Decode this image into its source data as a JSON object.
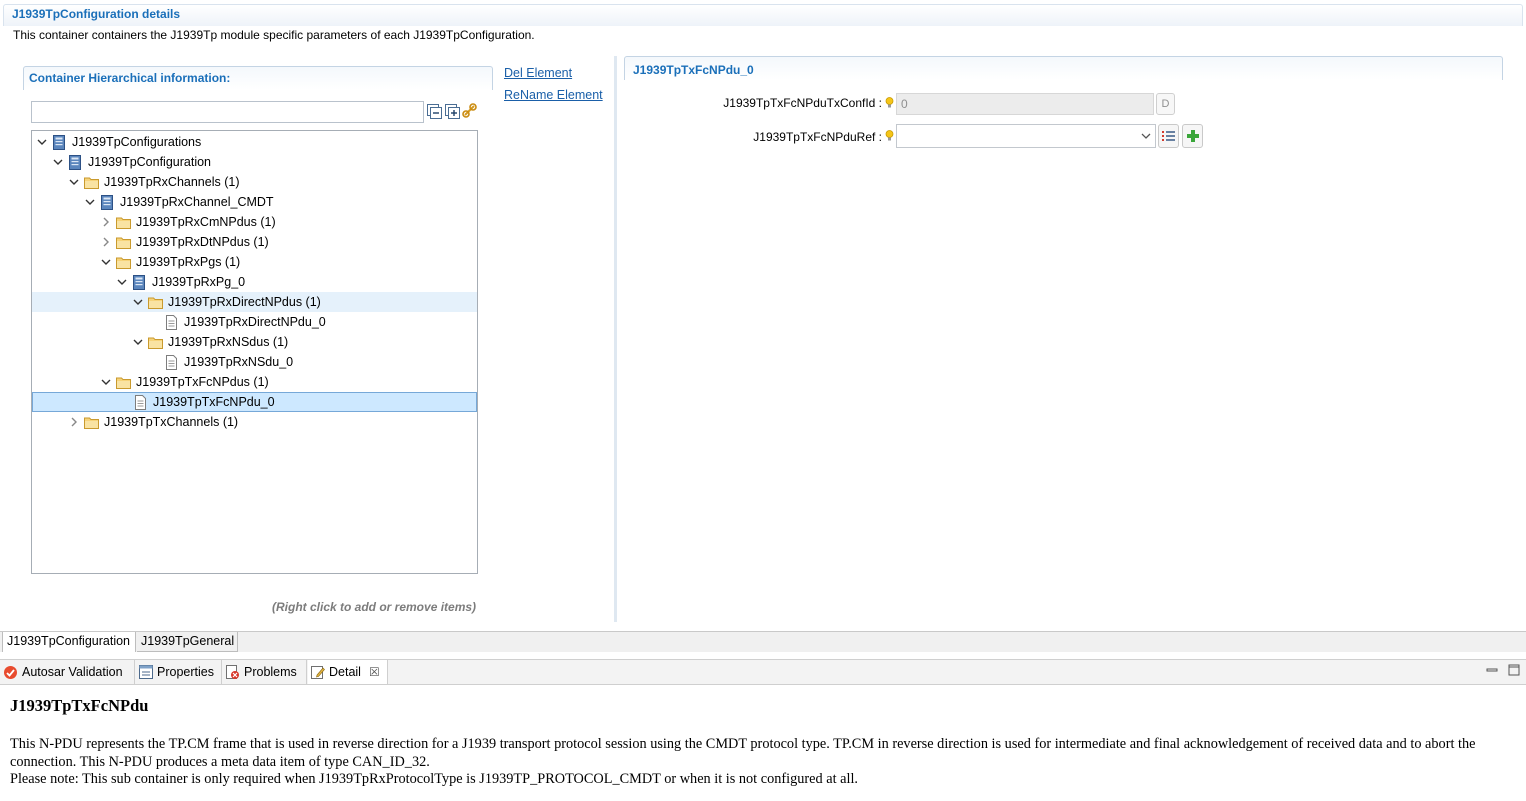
{
  "header": {
    "title": "J1939TpConfiguration details",
    "description": "This container containers the J1939Tp module specific parameters of each J1939TpConfiguration."
  },
  "hierarchy": {
    "title": "Container Hierarchical information:",
    "filter_value": "",
    "toolbar_icons": [
      "collapse-all-icon",
      "expand-all-icon",
      "link-with-editor-icon"
    ],
    "hint": "(Right click to add or remove items)"
  },
  "tree": [
    {
      "label": "J1939TpConfigurations",
      "depth": 0,
      "expanded": true,
      "icon": "container-icon"
    },
    {
      "label": "J1939TpConfiguration",
      "depth": 1,
      "expanded": true,
      "icon": "container-icon"
    },
    {
      "label": "J1939TpRxChannels (1)",
      "depth": 2,
      "expanded": true,
      "icon": "folder-icon"
    },
    {
      "label": "J1939TpRxChannel_CMDT",
      "depth": 3,
      "expanded": true,
      "icon": "container-icon"
    },
    {
      "label": "J1939TpRxCmNPdus (1)",
      "depth": 4,
      "expanded": false,
      "icon": "folder-icon"
    },
    {
      "label": "J1939TpRxDtNPdus (1)",
      "depth": 4,
      "expanded": false,
      "icon": "folder-icon"
    },
    {
      "label": "J1939TpRxPgs (1)",
      "depth": 4,
      "expanded": true,
      "icon": "folder-icon"
    },
    {
      "label": "J1939TpRxPg_0",
      "depth": 5,
      "expanded": true,
      "icon": "container-icon"
    },
    {
      "label": "J1939TpRxDirectNPdus (1)",
      "depth": 6,
      "expanded": true,
      "icon": "folder-icon",
      "state": "hover"
    },
    {
      "label": "J1939TpRxDirectNPdu_0",
      "depth": 7,
      "icon": "document-icon"
    },
    {
      "label": "J1939TpRxNSdus (1)",
      "depth": 6,
      "expanded": true,
      "icon": "folder-icon"
    },
    {
      "label": "J1939TpRxNSdu_0",
      "depth": 7,
      "icon": "document-icon"
    },
    {
      "label": "J1939TpTxFcNPdus (1)",
      "depth": 4,
      "expanded": true,
      "icon": "folder-icon"
    },
    {
      "label": "J1939TpTxFcNPdu_0",
      "depth": 5,
      "icon": "document-icon",
      "state": "selected"
    },
    {
      "label": "J1939TpTxChannels (1)",
      "depth": 2,
      "expanded": false,
      "icon": "folder-icon"
    }
  ],
  "actions": {
    "del_label": "Del Element",
    "rename_label": "ReName Element"
  },
  "details": {
    "title": "J1939TpTxFcNPdu_0",
    "field1": {
      "label": "J1939TpTxFcNPduTxConfId :",
      "value": "0",
      "button": "D"
    },
    "field2": {
      "label": "J1939TpTxFcNPduRef :",
      "value": ""
    }
  },
  "editor_tabs": [
    {
      "label": "J1939TpConfiguration",
      "active": true
    },
    {
      "label": "J1939TpGeneral",
      "active": false
    }
  ],
  "views": [
    {
      "label": "Autosar Validation",
      "icon": "validation-icon"
    },
    {
      "label": "Properties",
      "icon": "properties-icon"
    },
    {
      "label": "Problems",
      "icon": "problems-icon"
    },
    {
      "label": "Detail",
      "icon": "detail-icon",
      "active": true,
      "close": "☒"
    }
  ],
  "detail_view": {
    "title": "J1939TpTxFcNPdu",
    "paragraph1": "This N-PDU represents the TP.CM frame that is used in reverse direction for a J1939 transport protocol session using the CMDT protocol type. TP.CM in reverse direction is used for intermediate and final acknowledgement of received data and to abort the connection. This N-PDU produces a meta data item of type CAN_ID_32.",
    "paragraph2": "Please note: This sub container is only required when J1939TpRxProtocolType is J1939TP_PROTOCOL_CMDT or when it is not configured at all."
  },
  "colors": {
    "accent": "#1a6fb9",
    "link": "#1a5fa8",
    "selection": "#cde8ff",
    "hover": "#e5f1fb",
    "folder": "#f3c65a",
    "container_icon": "#3d6fae"
  }
}
